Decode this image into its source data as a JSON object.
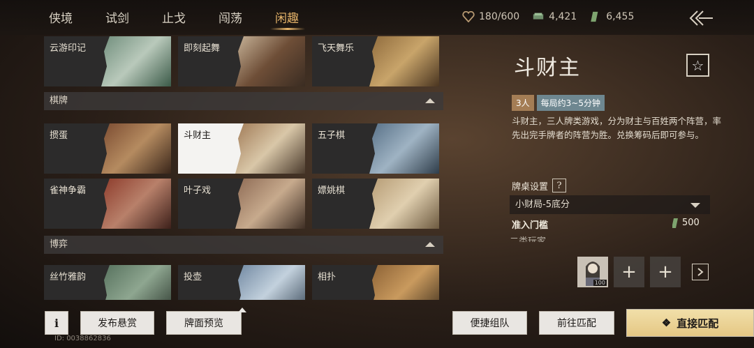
{
  "nav": {
    "tabs": [
      {
        "label": "侠境"
      },
      {
        "label": "试剑"
      },
      {
        "label": "止戈"
      },
      {
        "label": "闯荡"
      },
      {
        "label": "闲趣"
      }
    ],
    "active_index": 4
  },
  "resources": {
    "stamina": "180/600",
    "coins": "4,421",
    "tickets": "6,455"
  },
  "left": {
    "row0": [
      "云游印记",
      "即刻起舞",
      "飞天舞乐"
    ],
    "section_cards": "棋牌",
    "row1": [
      "掼蛋",
      "斗财主",
      "五子棋"
    ],
    "row2": [
      "雀神争霸",
      "叶子戏",
      "嫖姚棋"
    ],
    "section_boyi": "博弈",
    "row3": [
      "丝竹雅韵",
      "投壶",
      "相扑"
    ]
  },
  "detail": {
    "title": "斗财主",
    "fav_icon": "☆",
    "players": "3人",
    "duration": "每局约3~5分钟",
    "description": "斗财主，三人牌类游戏，分为财主与百姓两个阵营，率先出完手牌者的阵营为胜。兑换筹码后即可参与。",
    "table_setting_label": "牌桌设置",
    "help_icon": "?",
    "table_option": "小财局-5底分",
    "threshold_label": "准入门槛",
    "threshold_value": "500",
    "partial_row": "二类玩家"
  },
  "team": {
    "level": "100",
    "add_icon": "+"
  },
  "buttons": {
    "info": "i",
    "bounty": "发布悬赏",
    "preview": "牌面预览",
    "quick_team": "便捷组队",
    "goto_match": "前往匹配",
    "direct_match": "直接匹配",
    "direct_icon": "❖"
  },
  "uid": "ID: 0038862836",
  "colors": {
    "accent_gold": "#e7b56a",
    "badge_players": "#a47d55",
    "badge_duration": "#6e8790"
  }
}
